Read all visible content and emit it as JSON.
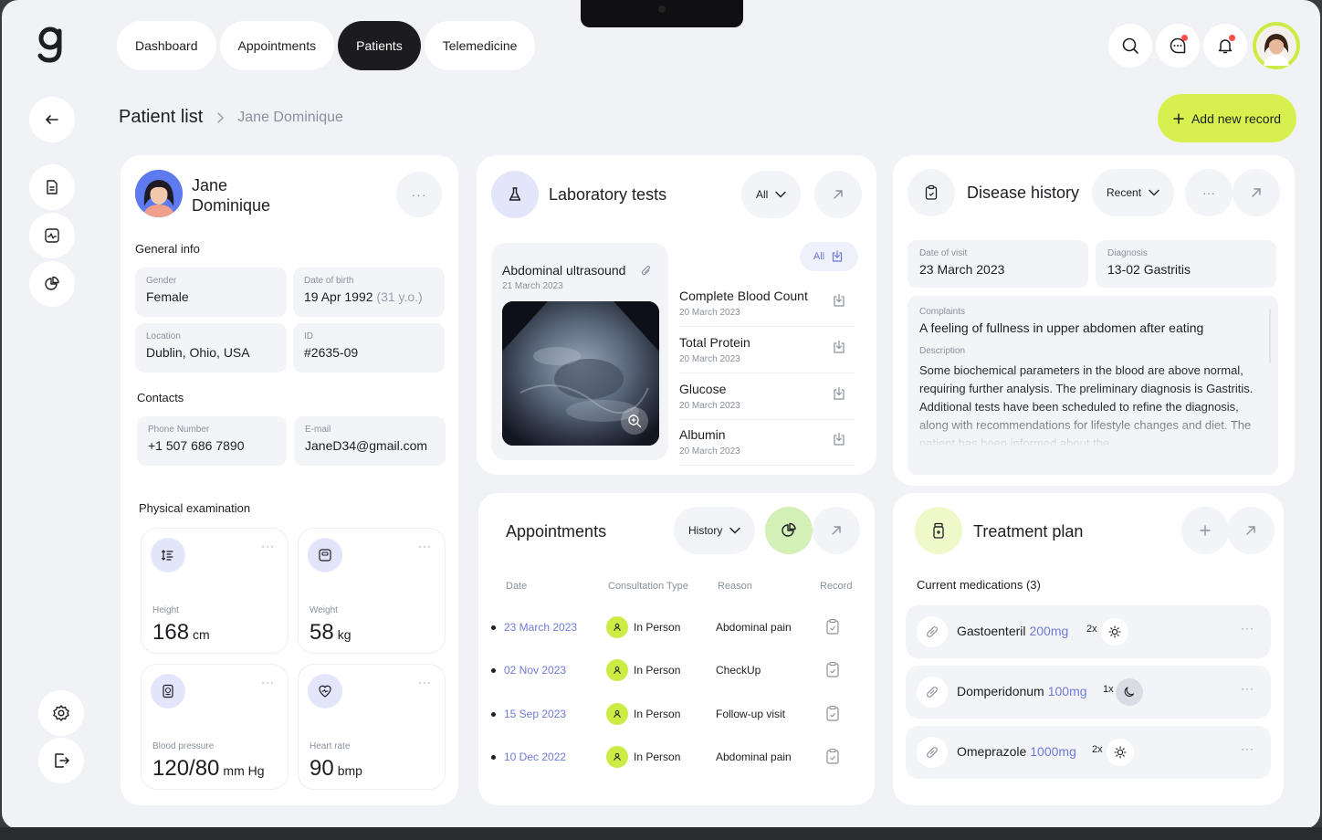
{
  "nav": {
    "tabs": [
      "Dashboard",
      "Appointments",
      "Patients",
      "Telemedicine"
    ],
    "active": "Patients"
  },
  "breadcrumb": {
    "title": "Patient list",
    "current": "Jane Dominique"
  },
  "add_record_label": "Add new record",
  "patient": {
    "name": "Jane Dominique",
    "general_info_title": "General info",
    "gender_label": "Gender",
    "gender": "Female",
    "dob_label": "Date of birth",
    "dob": "19 Apr 1992",
    "age": "(31 y.o.)",
    "location_label": "Location",
    "location": "Dublin, Ohio, USA",
    "id_label": "ID",
    "id": "#2635-09",
    "contacts_title": "Contacts",
    "phone_label": "Phone Number",
    "phone": "+1 507 686 7890",
    "email_label": "E-mail",
    "email": "JaneD34@gmail.com",
    "physical_title": "Physical examination",
    "metrics": [
      {
        "label": "Height",
        "value": "168",
        "unit": "cm"
      },
      {
        "label": "Weight",
        "value": "58",
        "unit": "kg"
      },
      {
        "label": "Blood pressure",
        "value": "120/80",
        "unit": "mm Hg"
      },
      {
        "label": "Heart rate",
        "value": "90",
        "unit": "bmp"
      }
    ]
  },
  "labs": {
    "title": "Laboratory tests",
    "filter": "All",
    "chip": "All",
    "featured": {
      "name": "Abdominal ultrasound",
      "date": "21 March 2023"
    },
    "tests": [
      {
        "name": "Complete Blood Count",
        "date": "20 March 2023"
      },
      {
        "name": "Total Protein",
        "date": "20 March 2023"
      },
      {
        "name": "Glucose",
        "date": "20 March 2023"
      },
      {
        "name": "Albumin",
        "date": "20 March 2023"
      }
    ]
  },
  "appointments": {
    "title": "Appointments",
    "filter": "History",
    "columns": [
      "Date",
      "Consultation Type",
      "Reason",
      "Record"
    ],
    "rows": [
      {
        "date": "23 March 2023",
        "type": "In Person",
        "reason": "Abdominal pain"
      },
      {
        "date": "02 Nov 2023",
        "type": "In Person",
        "reason": "CheckUp"
      },
      {
        "date": "15 Sep 2023",
        "type": "In Person",
        "reason": "Follow-up visit"
      },
      {
        "date": "10 Dec 2022",
        "type": "In Person",
        "reason": "Abdominal pain"
      }
    ]
  },
  "disease": {
    "title": "Disease history",
    "filter": "Recent",
    "visit_label": "Date of visit",
    "visit": "23 March 2023",
    "diagnosis_label": "Diagnosis",
    "diagnosis": "13-02 Gastritis",
    "complaints_label": "Complaints",
    "complaints": "A feeling of fullness in upper abdomen after eating",
    "description_label": "Description",
    "description": "Some biochemical parameters in the blood are above normal, requiring further analysis. The preliminary diagnosis is Gastritis. Additional tests have been scheduled to refine the diagnosis, along with recommendations for lifestyle changes and diet. The patient has been informed about the"
  },
  "treatment": {
    "title": "Treatment plan",
    "subtitle": "Current medications (3)",
    "meds": [
      {
        "name": "Gastoenteril",
        "dose": "200mg",
        "freq": "2x",
        "time": "sun-icon"
      },
      {
        "name": "Domperidonum",
        "dose": "100mg",
        "freq": "1x",
        "time": "moon-icon"
      },
      {
        "name": "Omeprazole",
        "dose": "1000mg",
        "freq": "2x",
        "time": "sun-icon"
      }
    ]
  },
  "colors": {
    "accent": "#d7f04d",
    "active_nav": "#1c1c1f",
    "lavender": "#e3e5fb",
    "link": "#6e7bd6"
  }
}
